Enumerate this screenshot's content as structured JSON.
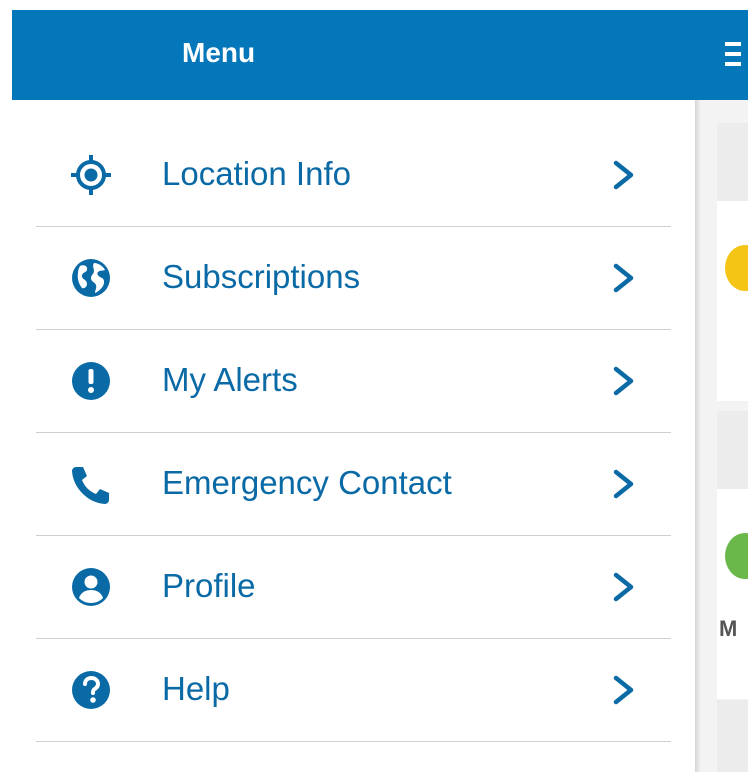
{
  "header": {
    "title": "Menu",
    "bg_color": "#0477bb"
  },
  "menu": {
    "accent_color": "#0a6aa6",
    "items": [
      {
        "label": "Location Info",
        "icon": "location-target-icon"
      },
      {
        "label": "Subscriptions",
        "icon": "globe-icon"
      },
      {
        "label": "My Alerts",
        "icon": "alert-exclamation-icon"
      },
      {
        "label": "Emergency Contact",
        "icon": "phone-icon"
      },
      {
        "label": "Profile",
        "icon": "user-profile-icon"
      },
      {
        "label": "Help",
        "icon": "help-question-icon"
      }
    ]
  },
  "background": {
    "partial_letter": "M"
  }
}
